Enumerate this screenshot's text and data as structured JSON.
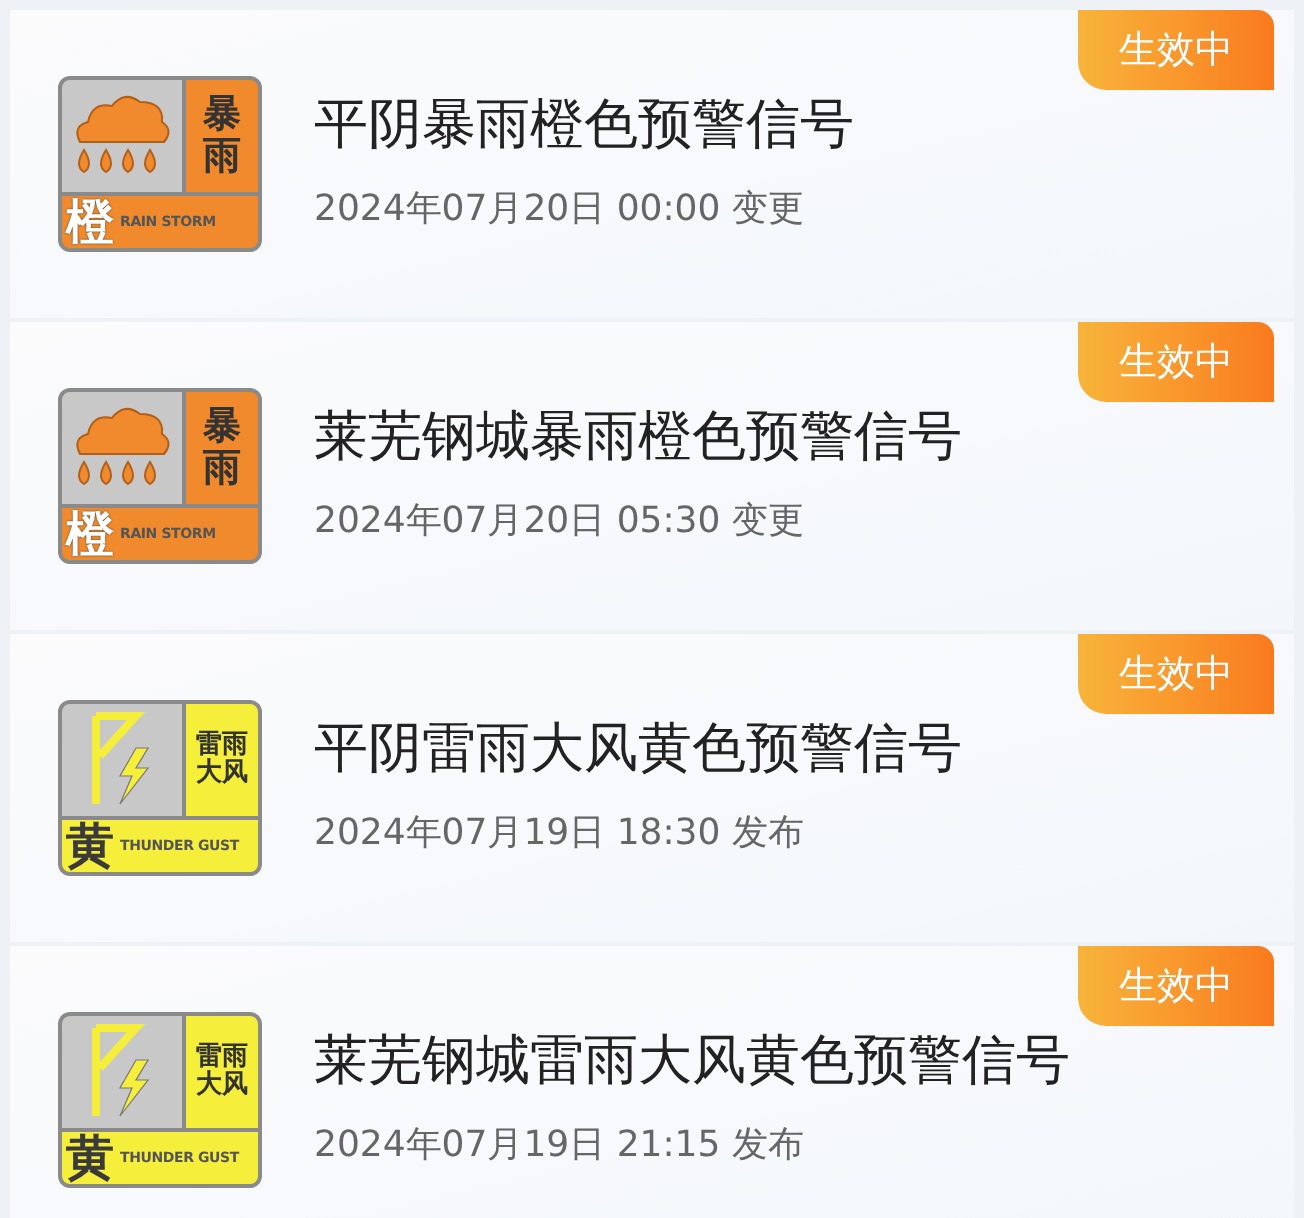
{
  "warnings": [
    {
      "title": "平阴暴雨橙色预警信号",
      "time": "2024年07月20日 00:00 变更",
      "status": "生效中",
      "icon": {
        "kind": "rainstorm",
        "color": "#f08a2c",
        "type_lines": [
          "暴",
          "雨"
        ],
        "level_char": "橙",
        "english": "RAIN STORM"
      }
    },
    {
      "title": "莱芜钢城暴雨橙色预警信号",
      "time": "2024年07月20日 05:30 变更",
      "status": "生效中",
      "icon": {
        "kind": "rainstorm",
        "color": "#f08a2c",
        "type_lines": [
          "暴",
          "雨"
        ],
        "level_char": "橙",
        "english": "RAIN STORM"
      }
    },
    {
      "title": "平阴雷雨大风黄色预警信号",
      "time": "2024年07月19日 18:30 发布",
      "status": "生效中",
      "icon": {
        "kind": "thunder_gust",
        "color": "#f5ee3a",
        "type_lines": [
          "雷雨",
          "大风"
        ],
        "level_char": "黄",
        "english": "THUNDER GUST"
      }
    },
    {
      "title": "莱芜钢城雷雨大风黄色预警信号",
      "time": "2024年07月19日 21:15 发布",
      "status": "生效中",
      "icon": {
        "kind": "thunder_gust",
        "color": "#f5ee3a",
        "type_lines": [
          "雷雨",
          "大风"
        ],
        "level_char": "黄",
        "english": "THUNDER GUST"
      }
    }
  ]
}
